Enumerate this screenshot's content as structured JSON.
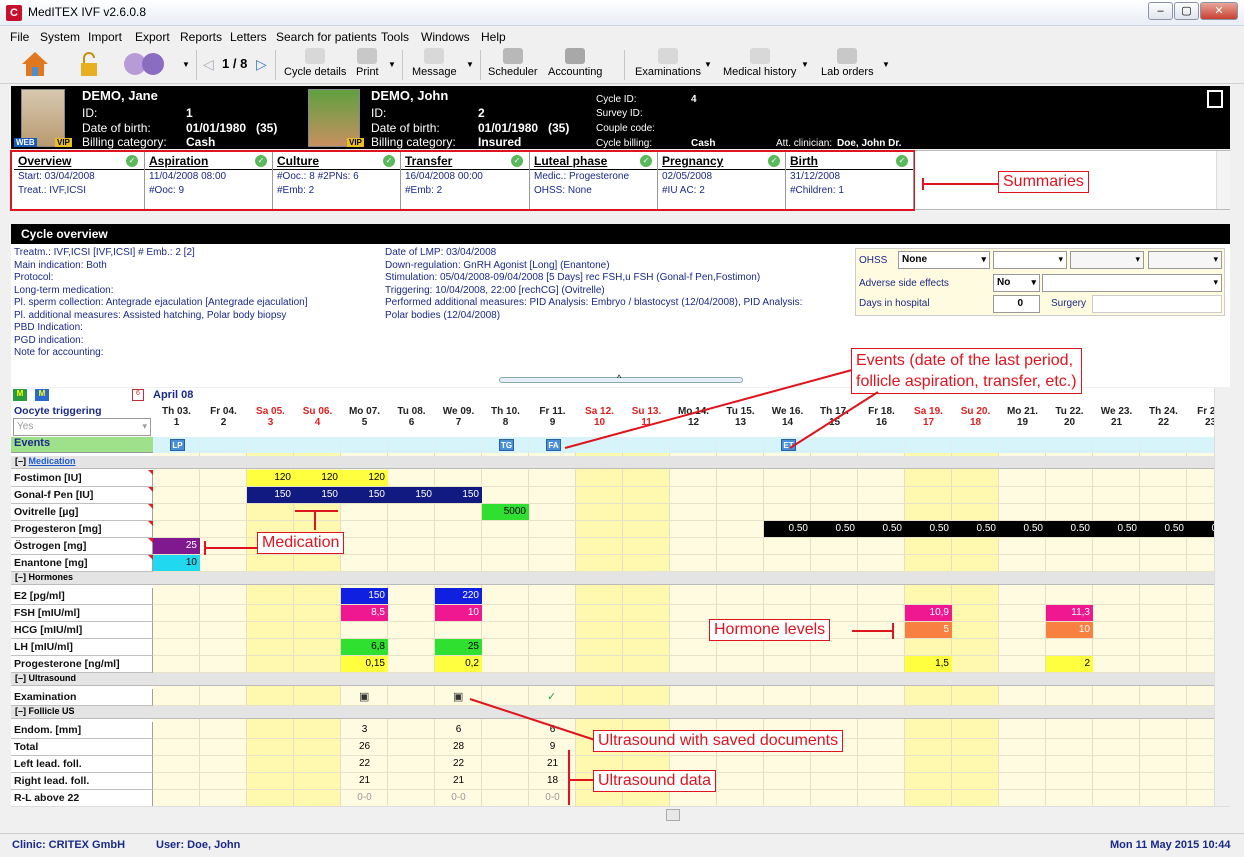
{
  "window": {
    "title": "MedITEX IVF v2.6.0.8",
    "icon": "meditex-logo-icon"
  },
  "menu": [
    "File",
    "System",
    "Import",
    "Export",
    "Reports",
    "Letters",
    "Search for patients",
    "Tools",
    "Windows",
    "Help"
  ],
  "toolbar": {
    "pager": "1 / 8",
    "buttons": [
      "Cycle details",
      "Print",
      "Message",
      "Scheduler",
      "Accounting",
      "Examinations",
      "Medical history",
      "Lab orders"
    ]
  },
  "patient_female": {
    "name": "DEMO, Jane",
    "id_label": "ID:",
    "id": "1",
    "dob_label": "Date of birth:",
    "dob": "01/01/1980",
    "age": "(35)",
    "billing_label": "Billing category:",
    "billing": "Cash"
  },
  "patient_male": {
    "name": "DEMO, John",
    "id_label": "ID:",
    "id": "2",
    "dob_label": "Date of birth:",
    "dob": "01/01/1980",
    "age": "(35)",
    "billing_label": "Billing category:",
    "billing": "Insured"
  },
  "cycle_info": {
    "cycle_id_label": "Cycle ID:",
    "cycle_id": "4",
    "survey_label": "Survey ID:",
    "couple_label": "Couple code:",
    "billing_label": "Cycle billing:",
    "billing": "Cash",
    "clinician_label": "Att. clinician:",
    "clinician": "Doe, John Dr."
  },
  "summaries": [
    {
      "title": "Overview",
      "l1": "Start: 03/04/2008",
      "l2": "Treat.: IVF,ICSI"
    },
    {
      "title": "Aspiration",
      "l1": "11/04/2008 08:00",
      "l2": "#Ooc: 9"
    },
    {
      "title": "Culture",
      "l1": "#Ooc.: 8 #2PNs: 6",
      "l2": "#Emb: 2"
    },
    {
      "title": "Transfer",
      "l1": "16/04/2008 00:00",
      "l2": "#Emb: 2"
    },
    {
      "title": "Luteal phase",
      "l1": "Medic.: Progesterone",
      "l2": "OHSS: None"
    },
    {
      "title": "Pregnancy",
      "l1": "02/05/2008",
      "l2": "#IU AC: 2"
    },
    {
      "title": "Birth",
      "l1": "31/12/2008",
      "l2": "#Children: 1"
    }
  ],
  "annotations": {
    "summaries": "Summaries",
    "events": "Events (date of the last period,\nfollicle aspiration, transfer, etc.)",
    "medication": "Medication",
    "hormones": "Hormone levels",
    "us_docs": "Ultrasound with saved documents",
    "us_data": "Ultrasound data"
  },
  "cycle_overview": {
    "title": "Cycle overview",
    "left": [
      "Treatm.: IVF,ICSI     [IVF,ICSI]      # Emb.: 2     [2]",
      "Main indication: Both",
      "Protocol:",
      "Long-term medication:",
      "Pl. sperm collection: Antegrade ejaculation     [Antegrade ejaculation]",
      "Pl. additional measures: Assisted hatching, Polar body biopsy",
      "PBD Indication:",
      "PGD indication:",
      "Note for accounting:"
    ],
    "right": [
      "Date of LMP: 03/04/2008",
      "Down-regulation: GnRH Agonist [Long] (Enantone)",
      "Stimulation: 05/04/2008-09/04/2008 [5 Days] rec FSH,u FSH (Gonal-f Pen,Fostimon)",
      "Triggering: 10/04/2008, 22:00  [rechCG] (Ovitrelle)",
      "Performed additional measures: PID Analysis: Embryo / blastocyst (12/04/2008), PID Analysis:",
      "Polar bodies (12/04/2008)"
    ],
    "ohss_label": "OHSS",
    "ohss_value": "None",
    "adverse_label": "Adverse side effects",
    "adverse_value": "No",
    "days_label": "Days in hospital",
    "days_value": "0",
    "surgery_label": "Surgery"
  },
  "grid": {
    "month": "April 08",
    "trig_label": "Oocyte triggering",
    "trig_value": "Yes",
    "days": [
      [
        "Th 03.",
        "1"
      ],
      [
        "Fr 04.",
        "2"
      ],
      [
        "Sa 05.",
        "3"
      ],
      [
        "Su 06.",
        "4"
      ],
      [
        "Mo 07.",
        "5"
      ],
      [
        "Tu 08.",
        "6"
      ],
      [
        "We 09.",
        "7"
      ],
      [
        "Th 10.",
        "8"
      ],
      [
        "Fr 11.",
        "9"
      ],
      [
        "Sa 12.",
        "10"
      ],
      [
        "Su 13.",
        "11"
      ],
      [
        "Mo 14.",
        "12"
      ],
      [
        "Tu 15.",
        "13"
      ],
      [
        "We 16.",
        "14"
      ],
      [
        "Th 17.",
        "15"
      ],
      [
        "Fr 18.",
        "16"
      ],
      [
        "Sa 19.",
        "17"
      ],
      [
        "Su 20.",
        "18"
      ],
      [
        "Mo 21.",
        "19"
      ],
      [
        "Tu 22.",
        "20"
      ],
      [
        "We 23.",
        "21"
      ],
      [
        "Th 24.",
        "22"
      ],
      [
        "Fr 25.",
        "23"
      ]
    ],
    "events_label": "Events",
    "events": [
      {
        "day": 0,
        "code": "LP"
      },
      {
        "day": 7,
        "code": "TG"
      },
      {
        "day": 8,
        "code": "FA"
      },
      {
        "day": 13,
        "code": "ET"
      }
    ],
    "sec_med": "Medication",
    "sec_horm": "Hormones",
    "sec_us": "Ultrasound",
    "sec_fus": "Follicle US",
    "med_rows": [
      "Fostimon [IU]",
      "Gonal-f Pen [IU]",
      "Ovitrelle [µg]",
      "Progesteron [mg]",
      "Östrogen [mg]",
      "Enantone [mg]"
    ],
    "horm_rows": [
      "E2  [pg/ml]",
      "FSH  [mIU/ml]",
      "HCG  [mIU/ml]",
      "LH  [mIU/ml]",
      "Progesterone  [ng/ml]"
    ],
    "us_rows": [
      "Examination"
    ],
    "fus_rows": [
      "Endom. [mm]",
      "Total",
      "Left lead. foll.",
      "Right lead. foll.",
      "R-L above 22"
    ],
    "fus_values": {
      "5": [
        "3",
        "26",
        "22",
        "21",
        "0-0"
      ],
      "7": [
        "6",
        "28",
        "22",
        "21",
        "0-0"
      ],
      "9": [
        "6",
        "9",
        "21",
        "18",
        "0-0"
      ]
    }
  },
  "status": {
    "clinic": "Clinic: CRITEX GmbH",
    "user": "User: Doe, John",
    "datetime": "Mon 11 May 2015 10:44"
  }
}
